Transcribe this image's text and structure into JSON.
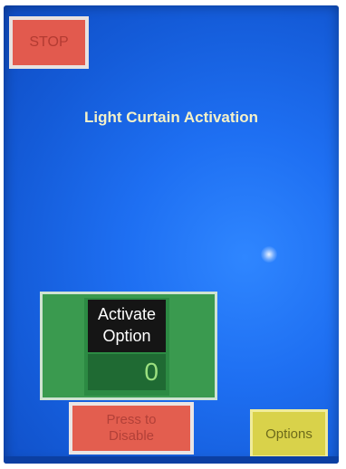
{
  "screen": {
    "background_color": "#1e6ff2",
    "title": "Light Curtain Activation"
  },
  "stop_button": {
    "label": "STOP",
    "color": "#e25a4e"
  },
  "activate_panel": {
    "label_line1": "Activate",
    "label_line2": "Option",
    "value": "0",
    "color": "#3a9a4f"
  },
  "disable_button": {
    "label_line1": "Press to",
    "label_line2": "Disable",
    "color": "#e35e4f"
  },
  "options_button": {
    "label": "Options",
    "color": "#d9d24a"
  }
}
